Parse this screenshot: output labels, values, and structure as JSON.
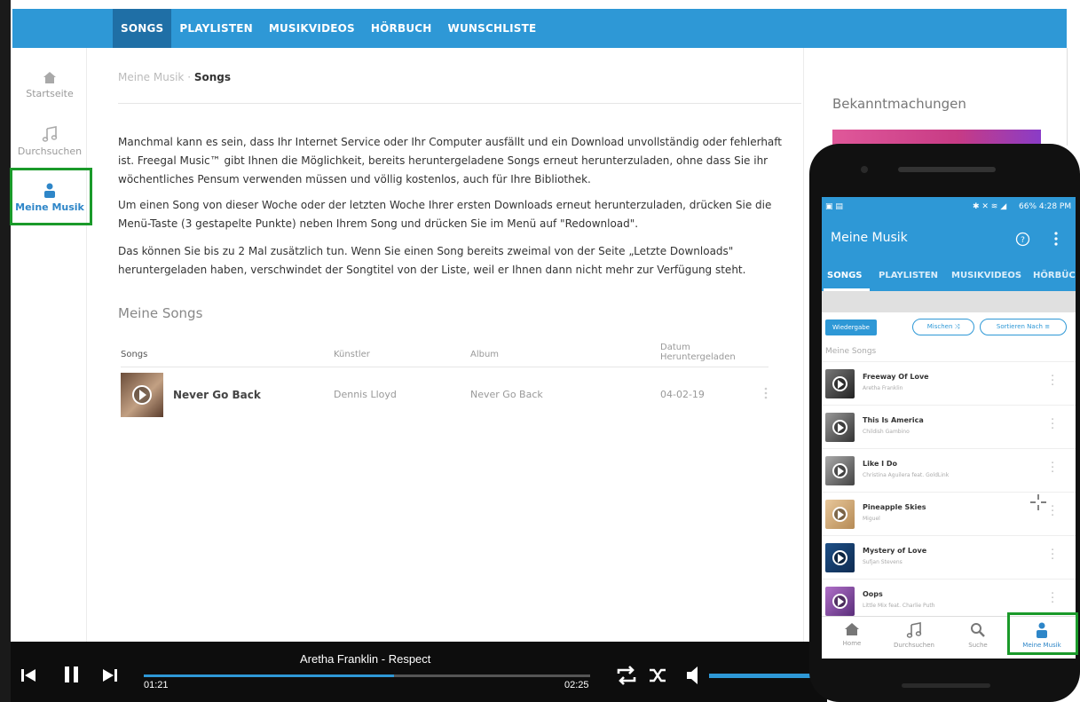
{
  "topnav": {
    "tabs": [
      "SONGS",
      "PLAYLISTEN",
      "MUSIKVIDEOS",
      "HÖRBUCH",
      "WUNSCHLISTE"
    ],
    "active_tab": "SONGS"
  },
  "sidebar": {
    "items": [
      {
        "label": "Startseite",
        "icon": "home-icon"
      },
      {
        "label": "Durchsuchen",
        "icon": "music-note-icon"
      },
      {
        "label": "Meine Musik",
        "icon": "user-icon",
        "active": true
      }
    ]
  },
  "main": {
    "breadcrumb_parent": "Meine Musik",
    "breadcrumb_sep": " · ",
    "breadcrumb_current": "Songs",
    "paragraphs": [
      "Manchmal kann es sein, dass Ihr Internet Service oder Ihr Computer ausfällt und ein Download unvollständig oder fehlerhaft ist. Freegal Music™ gibt Ihnen die Möglichkeit, bereits heruntergeladene Songs erneut herunterzuladen, ohne dass Sie ihr wöchentliches Pensum verwenden müssen und völlig kostenlos, auch für Ihre Bibliothek.",
      "Um einen Song von dieser Woche oder der letzten Woche Ihrer ersten Downloads erneut herunterzuladen, drücken Sie die Menü-Taste (3 gestapelte Punkte) neben Ihrem Song und drücken Sie im Menü auf \"Redownload\".",
      "Das können Sie bis zu 2 Mal zusätzlich tun. Wenn Sie einen Song bereits zweimal von der Seite „Letzte Downloads\" heruntergeladen haben, verschwindet der Songtitel von der Liste, weil er Ihnen dann nicht mehr zur Verfügung steht."
    ],
    "section_title": "Meine Songs",
    "table": {
      "headers": [
        "Songs",
        "Künstler",
        "Album",
        "Datum Heruntergeladen"
      ],
      "rows": [
        {
          "song": "Never Go Back",
          "artist": "Dennis Lloyd",
          "album": "Never Go Back",
          "date": "04-02-19"
        }
      ]
    }
  },
  "rightcol": {
    "title": "Bekanntmachungen"
  },
  "player": {
    "now_playing": "Aretha Franklin - Respect",
    "elapsed": "01:21",
    "duration": "02:25",
    "progress": 0.56,
    "accent": "#2e98d6"
  },
  "phone": {
    "status_right": "66% 4:28 PM",
    "app_title": "Meine Musik",
    "tabs": [
      "SONGS",
      "PLAYLISTEN",
      "MUSIKVIDEOS",
      "HÖRBÜCH"
    ],
    "buttons": {
      "play": "Wiedergabe",
      "shuffle": "Mischen",
      "sort": "Sortieren Nach"
    },
    "section_title": "Meine Songs",
    "songs": [
      {
        "title": "Freeway Of Love",
        "artist": "Aretha Franklin"
      },
      {
        "title": "This Is America",
        "artist": "Childish Gambino"
      },
      {
        "title": "Like I Do",
        "artist": "Christina Aguilera feat. GoldLink"
      },
      {
        "title": "Pineapple Skies",
        "artist": "Miguel"
      },
      {
        "title": "Mystery of Love",
        "artist": "Sufjan Stevens"
      },
      {
        "title": "Oops",
        "artist": "Little Mix feat. Charlie Puth"
      }
    ],
    "bottom_nav": [
      {
        "label": "Home",
        "icon": "home-icon"
      },
      {
        "label": "Durchsuchen",
        "icon": "music-note-icon"
      },
      {
        "label": "Suche",
        "icon": "search-icon"
      },
      {
        "label": "Meine Musik",
        "icon": "user-icon",
        "active": true
      }
    ]
  },
  "colors": {
    "brand_blue": "#2e98d6",
    "highlight_green": "#1a9a2a"
  }
}
